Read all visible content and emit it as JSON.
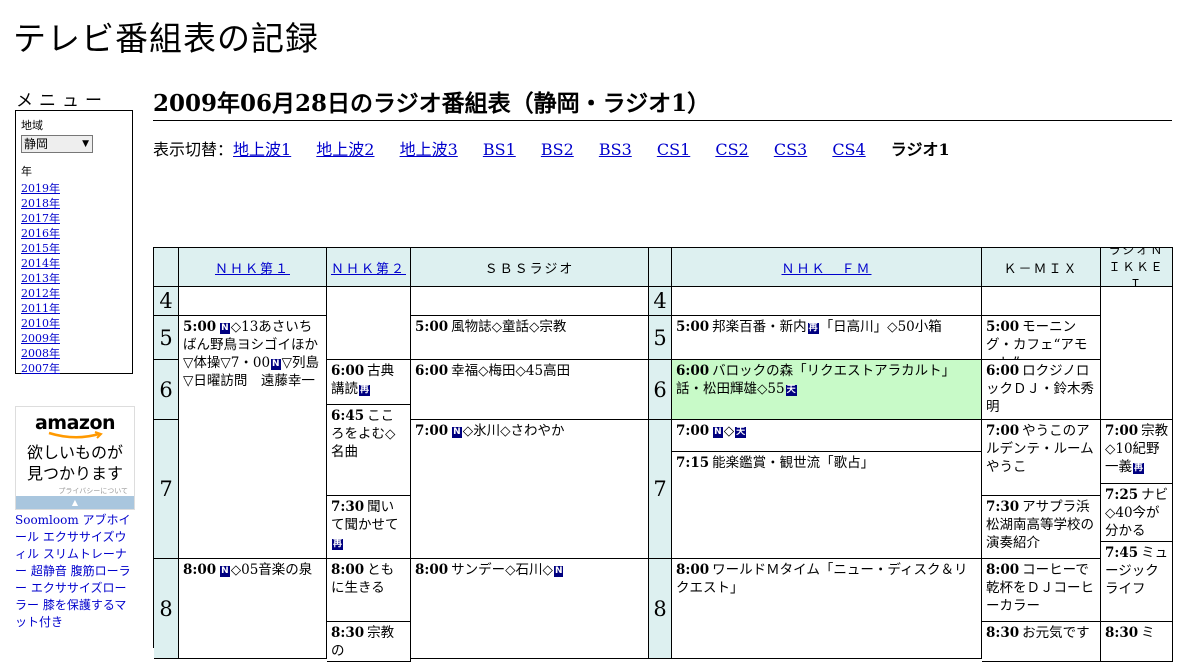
{
  "site_title": "テレビ番組表の記録",
  "menu": {
    "title": "メニュー",
    "region_label": "地域",
    "region_value": "静岡",
    "year_label": "年",
    "years": [
      "2019年",
      "2018年",
      "2017年",
      "2016年",
      "2015年",
      "2014年",
      "2013年",
      "2012年",
      "2011年",
      "2010年",
      "2009年",
      "2008年",
      "2007年"
    ]
  },
  "ad": {
    "logo": "amazon",
    "text_line1": "欲しいものが",
    "text_line2": "見つかります",
    "privacy": "プライバシーについて"
  },
  "links": [
    "Soomloom アブホイール エクササイズウィル スリムトレーナー 超静音 腹筋ローラー エクササイズローラー 膝を保護するマット付き"
  ],
  "page_heading": "2009年06月28日のラジオ番組表（静岡・ラジオ1）",
  "switcher": {
    "label": "表示切替：",
    "links": [
      "地上波1",
      "地上波2",
      "地上波3",
      "BS1",
      "BS2",
      "BS3",
      "CS1",
      "CS2",
      "CS3",
      "CS4"
    ],
    "current": "ラジオ1"
  },
  "channels": {
    "nhk1": "ＮＨＫ第１",
    "nhk2": "ＮＨＫ第２",
    "sbs": "ＳＢＳラジオ",
    "nhkfm": "ＮＨＫ　ＦＭ",
    "kmix": "Ｋ－ＭＩＸ",
    "nikkei": "ラジオＮＩＫＫＥＩ"
  },
  "hours": [
    "4",
    "5",
    "6",
    "7",
    "8"
  ],
  "programs": {
    "nhk1_500": {
      "time": "5:00",
      "icon": "N",
      "title": "◇13あさいちばん野鳥ヨシゴイほか▽体操▽7・00",
      "icon2": "N",
      "title2": "▽列島▽日曜訪問　遠藤幸一"
    },
    "nhk1_800": {
      "time": "8:00",
      "icon": "N",
      "title": "◇05音楽の泉"
    },
    "nhk2_600": {
      "time": "6:00",
      "title": "古典講読",
      "icon": "再"
    },
    "nhk2_645": {
      "time": "6:45",
      "title": "こころをよむ◇名曲"
    },
    "nhk2_730": {
      "time": "7:30",
      "title": "聞いて聞かせて",
      "icon": "再"
    },
    "nhk2_800": {
      "time": "8:00",
      "title": "ともに生きる"
    },
    "nhk2_830": {
      "time": "8:30",
      "title": "宗教の"
    },
    "sbs_500": {
      "time": "5:00",
      "title": "風物誌◇童話◇宗教"
    },
    "sbs_600": {
      "time": "6:00",
      "title": "幸福◇梅田◇45高田"
    },
    "sbs_700": {
      "time": "7:00",
      "icon": "N",
      "title": "◇氷川◇さわやか"
    },
    "sbs_800": {
      "time": "8:00",
      "title": "サンデー◇石川◇",
      "icon": "N"
    },
    "fm_500": {
      "time": "5:00",
      "title": "邦楽百番・新内",
      "icon": "再",
      "title2": "「日高川」◇50小箱"
    },
    "fm_600": {
      "time": "6:00",
      "title": "バロックの森「リクエストアラカルト」話・松田輝雄◇55",
      "icon": "天"
    },
    "fm_700": {
      "time": "7:00",
      "icon": "N",
      "title": "◇",
      "icon2": "天"
    },
    "fm_715": {
      "time": "7:15",
      "title": "能楽鑑賞・観世流「歌占」"
    },
    "fm_800": {
      "time": "8:00",
      "title": "ワールドＭタイム「ニュー・ディスク＆リクエスト」"
    },
    "kmix_500": {
      "time": "5:00",
      "title": "モーニング・カフェ“アモーレ”"
    },
    "kmix_600": {
      "time": "6:00",
      "title": "ロクジノロックＤＪ・鈴木秀明"
    },
    "kmix_700": {
      "time": "7:00",
      "title": "やうこのアルデンテ・ルームやうこ"
    },
    "kmix_730": {
      "time": "7:30",
      "title": "アサプラ浜松湖南高等学校の演奏紹介"
    },
    "kmix_800": {
      "time": "8:00",
      "title": "コーヒーで乾杯をＤＪコーヒーカラー"
    },
    "kmix_830": {
      "time": "8:30",
      "title": "お元気です"
    },
    "nikkei_700": {
      "time": "7:00",
      "title": "宗教◇10紀野一義",
      "icon": "再"
    },
    "nikkei_725": {
      "time": "7:25",
      "title": "ナビ◇40今が分かる"
    },
    "nikkei_745": {
      "time": "7:45",
      "title": "ミュージックライフ"
    },
    "nikkei_830": {
      "time": "8:30",
      "title": "ミ"
    }
  },
  "colors": {
    "header_bg": "#ddf0f0",
    "highlight_bg": "#c8fac8",
    "icon_bg": "#000080"
  }
}
